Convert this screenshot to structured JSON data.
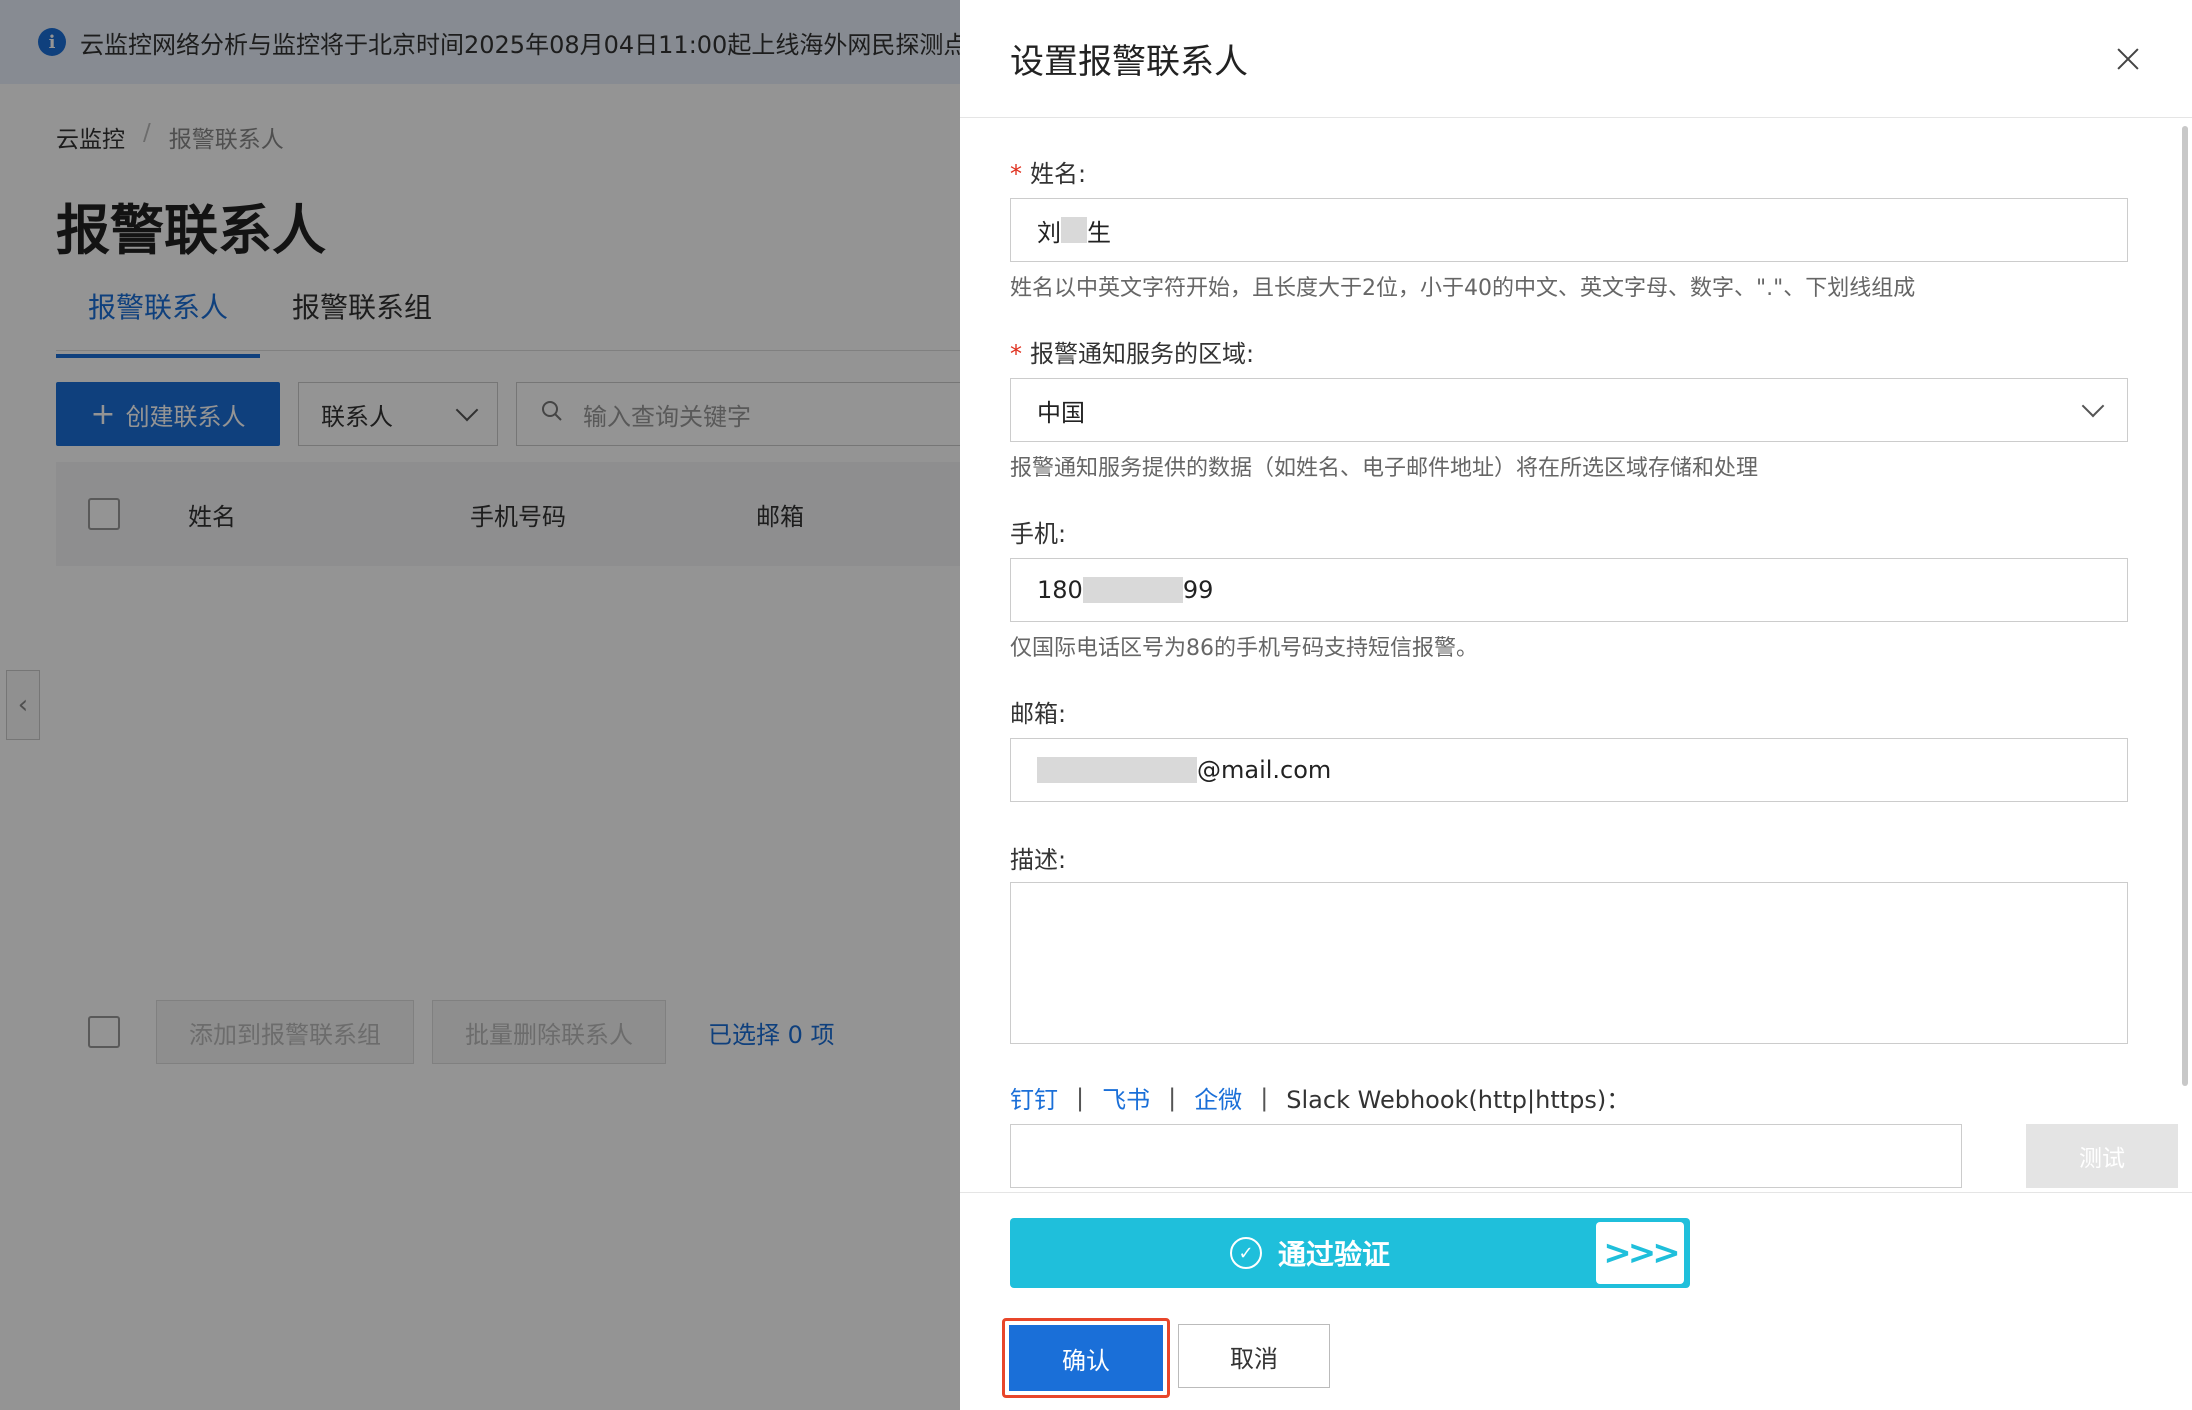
{
  "background": {
    "notice": "云监控网络分析与监控将于北京时间2025年08月04日11:00起上线海外网民探测点:",
    "breadcrumb": [
      "云监控",
      "/",
      "报警联系人"
    ],
    "page_title": "报警联系人",
    "tabs": [
      "报警联系人",
      "报警联系组"
    ],
    "create_button": "创建联系人",
    "contact_select": "联系人",
    "search_placeholder": "输入查询关键字",
    "table_headers": [
      "姓名",
      "手机号码",
      "邮箱"
    ],
    "footer_buttons": [
      "添加到报警联系组",
      "批量删除联系人"
    ],
    "selected_count": "已选择 0 项"
  },
  "drawer": {
    "title": "设置报警联系人",
    "name": {
      "label": "姓名:",
      "value_prefix": "刘",
      "value_suffix": "生",
      "hint": "姓名以中英文字符开始，且长度大于2位，小于40的中文、英文字母、数字、\".\"、下划线组成"
    },
    "region": {
      "label": "报警通知服务的区域:",
      "value": "中国",
      "hint": "报警通知服务提供的数据（如姓名、电子邮件地址）将在所选区域存储和处理"
    },
    "phone": {
      "label": "手机:",
      "value_prefix": "180",
      "value_suffix": "99",
      "hint": "仅国际电话区号为86的手机号码支持短信报警。"
    },
    "email": {
      "label": "邮箱:",
      "value_suffix": "@mail.com"
    },
    "description": {
      "label": "描述:"
    },
    "webhook": {
      "links": [
        "钉钉",
        "飞书",
        "企微"
      ],
      "separator": "|",
      "label": "Slack Webhook(http|https)：",
      "test_button": "测试"
    },
    "verify": {
      "text": "通过验证",
      "handle": ">>>"
    },
    "confirm_button": "确认",
    "cancel_button": "取消"
  },
  "colors": {
    "primary": "#1a6fd8",
    "verify": "#1fbfdb",
    "required": "#e0301e",
    "highlight": "#e8462a"
  }
}
